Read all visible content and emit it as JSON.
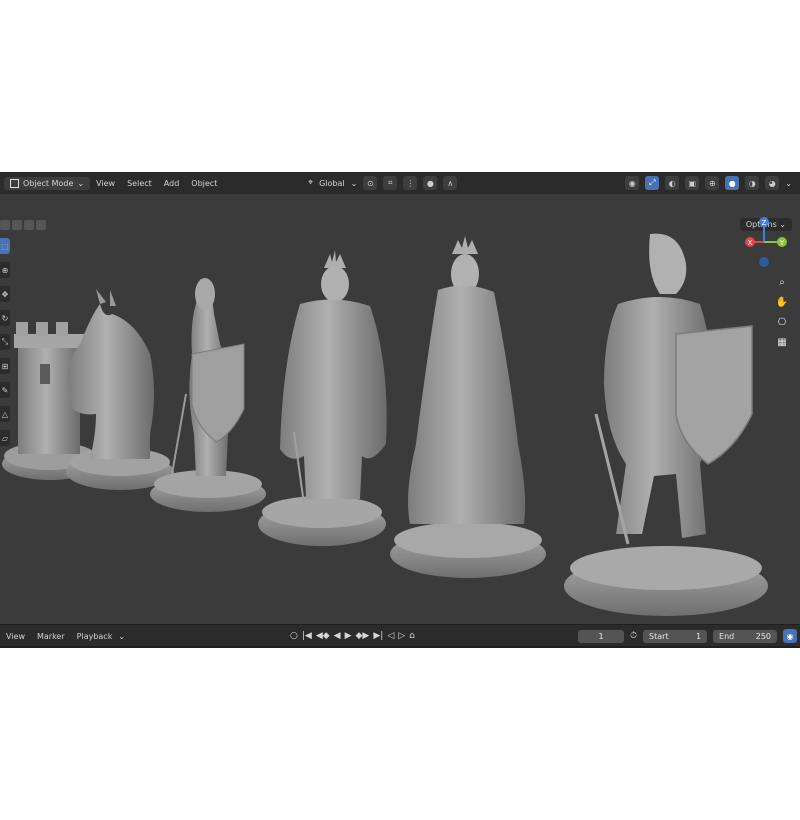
{
  "header": {
    "mode_label": "Object Mode",
    "menus": [
      "View",
      "Select",
      "Add",
      "Object"
    ],
    "transform_orientation": "Global",
    "options_label": "Options"
  },
  "gizmo": {
    "axes": [
      "Z",
      "X",
      "Y"
    ],
    "colors": {
      "x": "#e0444d",
      "y": "#8ac33d",
      "z": "#3f7fe0"
    }
  },
  "timeline": {
    "menus": [
      "View",
      "Marker",
      "Playback"
    ],
    "current_frame": "1",
    "start_label": "Start",
    "start_value": "1",
    "end_label": "End",
    "end_value": "250"
  },
  "scene": {
    "pieces": [
      "rook",
      "knight",
      "bishop",
      "king",
      "queen",
      "knight-figure"
    ]
  },
  "colors": {
    "accent": "#4772b3",
    "viewport": "#3b3b3b",
    "header": "#2b2b2b"
  }
}
